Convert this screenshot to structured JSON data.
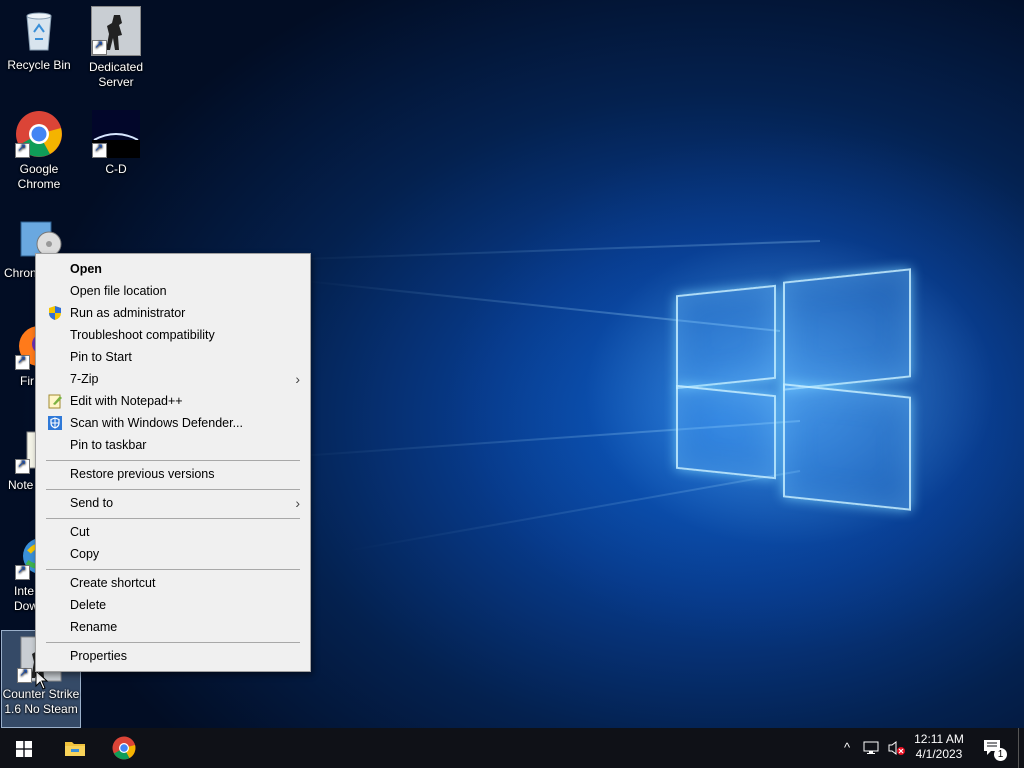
{
  "desktop": {
    "icons": [
      {
        "label": "Recycle Bin"
      },
      {
        "label": "Dedicated Server"
      },
      {
        "label": "Google Chrome"
      },
      {
        "label": "C-D"
      },
      {
        "label": "Chron"
      },
      {
        "label": "Fir"
      },
      {
        "label": "Note"
      },
      {
        "label": "Inte Dow"
      },
      {
        "label": "Counter Strike 1.6 No Steam"
      }
    ]
  },
  "context_menu": {
    "items": [
      {
        "label": "Open",
        "bold": true
      },
      {
        "label": "Open file location"
      },
      {
        "label": "Run as administrator",
        "icon": "uac-shield-icon"
      },
      {
        "label": "Troubleshoot compatibility"
      },
      {
        "label": "Pin to Start"
      },
      {
        "label": "7-Zip",
        "submenu": true
      },
      {
        "label": "Edit with Notepad++",
        "icon": "notepadpp-icon"
      },
      {
        "label": "Scan with Windows Defender...",
        "icon": "defender-icon"
      },
      {
        "label": "Pin to taskbar"
      },
      {
        "label": "Restore previous versions"
      },
      {
        "label": "Send to",
        "submenu": true
      },
      {
        "label": "Cut"
      },
      {
        "label": "Copy"
      },
      {
        "label": "Create shortcut"
      },
      {
        "label": "Delete"
      },
      {
        "label": "Rename"
      },
      {
        "label": "Properties"
      }
    ],
    "submenu_arrow": "›"
  },
  "taskbar": {
    "pinned": [
      "start-button",
      "file-explorer-icon",
      "chrome-icon"
    ],
    "tray": {
      "chevron": "^",
      "time": "12:11 AM",
      "date": "4/1/2023",
      "notification_count": "1"
    }
  },
  "colors": {
    "menu_bg": "#f0f0f0",
    "taskbar_bg": "#0f1117",
    "wallpaper_blue": "#0b5dc4"
  }
}
